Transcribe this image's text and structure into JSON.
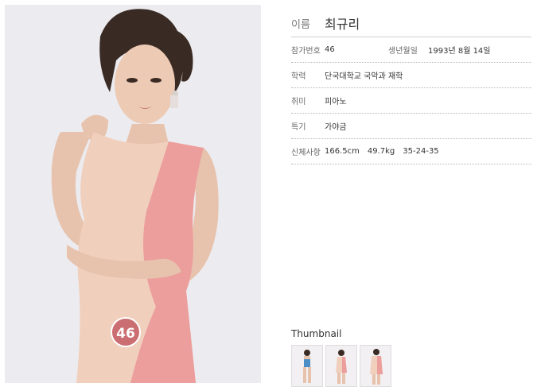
{
  "profile": {
    "name_label": "이름",
    "name_value": "최규리",
    "entry_no_label": "참가번호",
    "entry_no_value": "46",
    "birth_label": "생년월일",
    "birth_value": "1993년 8월 14일",
    "school_label": "학력",
    "school_value": "단국대학교 국악과 재학",
    "hobby_label": "취미",
    "hobby_value": "피아노",
    "talent_label": "특기",
    "talent_value": "가야금",
    "body_label": "신체사항",
    "height_value": "166.5cm",
    "weight_value": "49.7kg",
    "measurements_value": "35-24-35"
  },
  "photo": {
    "badge_number": "46"
  },
  "thumbnails": {
    "title": "Thumbnail",
    "items": [
      {
        "style": "swimsuit"
      },
      {
        "style": "dress"
      },
      {
        "style": "dress-side"
      }
    ]
  },
  "colors": {
    "dress_peach": "#f0cfbd",
    "dress_pink": "#ec9e9c",
    "badge": "#cb6e72",
    "background": "#ecebef"
  }
}
